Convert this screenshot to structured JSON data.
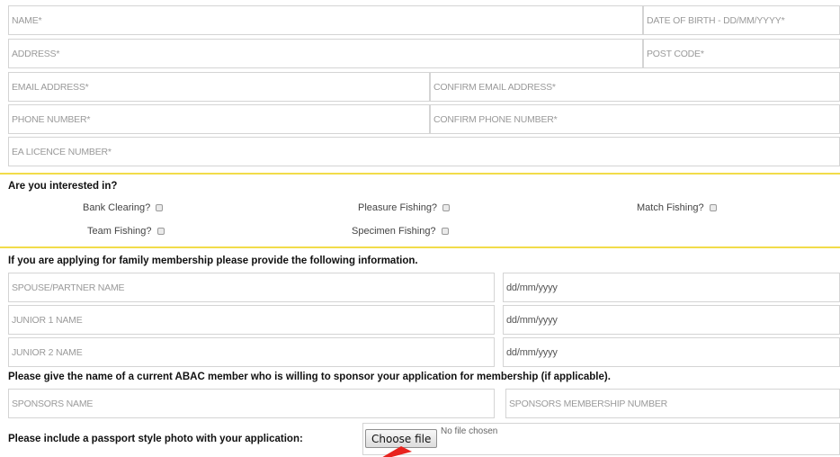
{
  "personal": {
    "name_placeholder": "NAME*",
    "dob_placeholder": "DATE OF BIRTH - DD/MM/YYYY*",
    "address_placeholder": "ADDRESS*",
    "postcode_placeholder": "POST CODE*",
    "email_placeholder": "EMAIL ADDRESS*",
    "confirm_email_placeholder": "CONFIRM EMAIL ADDRESS*",
    "phone_placeholder": "PHONE NUMBER*",
    "confirm_phone_placeholder": "CONFIRM PHONE NUMBER*",
    "licence_placeholder": "EA LICENCE NUMBER*"
  },
  "interests": {
    "heading": "Are you interested in?",
    "options": [
      {
        "label": "Bank Clearing?",
        "checked": false
      },
      {
        "label": "Pleasure Fishing?",
        "checked": false
      },
      {
        "label": "Match Fishing?",
        "checked": false
      },
      {
        "label": "Team Fishing?",
        "checked": false
      },
      {
        "label": "Specimen Fishing?",
        "checked": false
      }
    ]
  },
  "family": {
    "heading": "If you are applying for family membership please provide the following information.",
    "spouse_placeholder": "SPOUSE/PARTNER NAME",
    "junior1_placeholder": "JUNIOR 1 NAME",
    "junior2_placeholder": "JUNIOR 2 NAME",
    "date_placeholder": "dd/mm/yyyy"
  },
  "sponsor": {
    "heading": "Please give the name of a current ABAC member who is willing to sponsor your application for membership (if applicable).",
    "name_placeholder": "SPONSORS NAME",
    "number_placeholder": "SPONSORS MEMBERSHIP NUMBER"
  },
  "photo": {
    "heading": "Please include a passport style photo with your application:",
    "button_label": "Choose file",
    "status": "No file chosen"
  },
  "colors": {
    "divider": "#f2dc4a",
    "arrow": "#e8231e"
  }
}
